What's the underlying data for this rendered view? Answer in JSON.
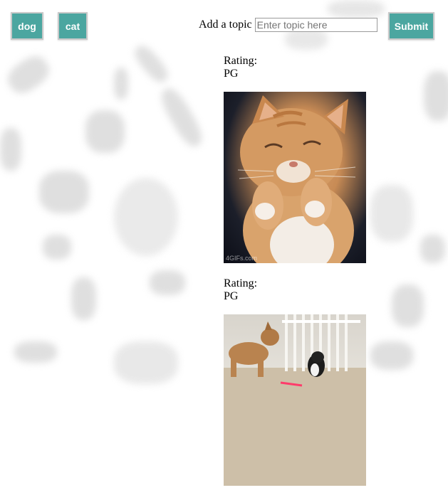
{
  "topics": {
    "buttons": [
      {
        "label": "dog"
      },
      {
        "label": "cat"
      }
    ]
  },
  "add_topic": {
    "label": "Add a topic",
    "input_placeholder": "Enter topic here",
    "input_value": "",
    "submit_label": "Submit"
  },
  "results": [
    {
      "rating_label": "Rating:",
      "rating": "PG",
      "watermark": "4GIFs.com",
      "image": "cat-gif"
    },
    {
      "rating_label": "Rating:",
      "rating": "PG",
      "image": "dog-cat-gif"
    }
  ],
  "colors": {
    "button_bg": "#4ba6a0",
    "button_text": "#ffffff"
  }
}
